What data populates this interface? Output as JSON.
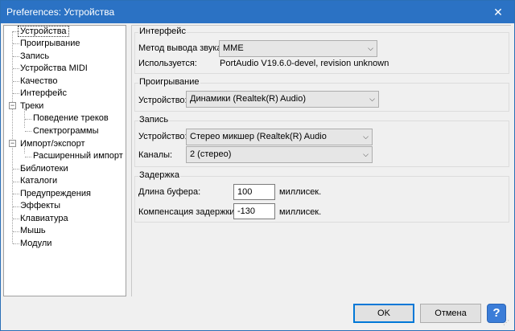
{
  "window": {
    "title": "Preferences: Устройства",
    "close_glyph": "✕"
  },
  "tree": {
    "items": [
      {
        "label": "Устройства"
      },
      {
        "label": "Проигрывание"
      },
      {
        "label": "Запись"
      },
      {
        "label": "Устройства MIDI"
      },
      {
        "label": "Качество"
      },
      {
        "label": "Интерфейс"
      },
      {
        "label": "Треки"
      },
      {
        "label": "Поведение треков"
      },
      {
        "label": "Спектрограммы"
      },
      {
        "label": "Импорт/экспорт"
      },
      {
        "label": "Расширенный импорт"
      },
      {
        "label": "Библиотеки"
      },
      {
        "label": "Каталоги"
      },
      {
        "label": "Предупреждения"
      },
      {
        "label": "Эффекты"
      },
      {
        "label": "Клавиатура"
      },
      {
        "label": "Мышь"
      },
      {
        "label": "Модули"
      }
    ],
    "expander_glyph": "−"
  },
  "interface": {
    "title": "Интерфейс",
    "host_label": "Метод вывода звука:",
    "host_value": "MME",
    "using_label": "Используется:",
    "using_value": "PortAudio V19.6.0-devel, revision unknown"
  },
  "playback": {
    "title": "Проигрывание",
    "device_label": "Устройство:",
    "device_value": "Динамики (Realtek(R) Audio)"
  },
  "recording": {
    "title": "Запись",
    "device_label": "Устройство:",
    "device_value": "Стерео микшер (Realtek(R) Audio",
    "channels_label": "Каналы:",
    "channels_value": "2 (стерео)"
  },
  "latency": {
    "title": "Задержка",
    "buffer_label": "Длина буфера:",
    "buffer_value": "100",
    "buffer_unit": "миллисек.",
    "comp_label": "Компенсация задержки:",
    "comp_value": "-130",
    "comp_unit": "миллисек."
  },
  "buttons": {
    "ok": "OK",
    "cancel": "Отмена",
    "help": "?"
  },
  "colors": {
    "titlebar": "#2b72c4",
    "help": "#3b7dd8"
  }
}
